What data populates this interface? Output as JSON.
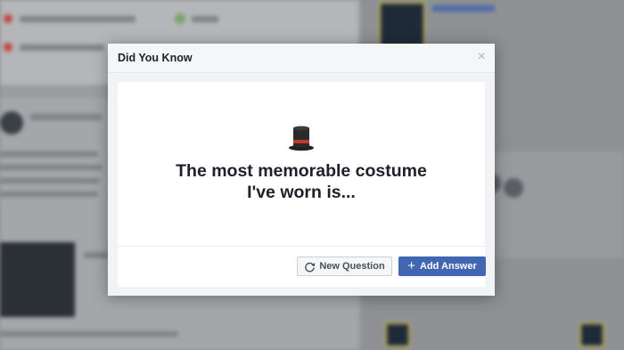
{
  "dialog": {
    "title": "Did You Know",
    "close_glyph": "×",
    "hat_icon": "top-hat-icon",
    "question_line1": "The most memorable costume",
    "question_line2": "I've worn is...",
    "new_question_label": "New Question",
    "add_answer_label": "Add Answer",
    "add_glyph": "+",
    "accent_color": "#4267b2"
  }
}
